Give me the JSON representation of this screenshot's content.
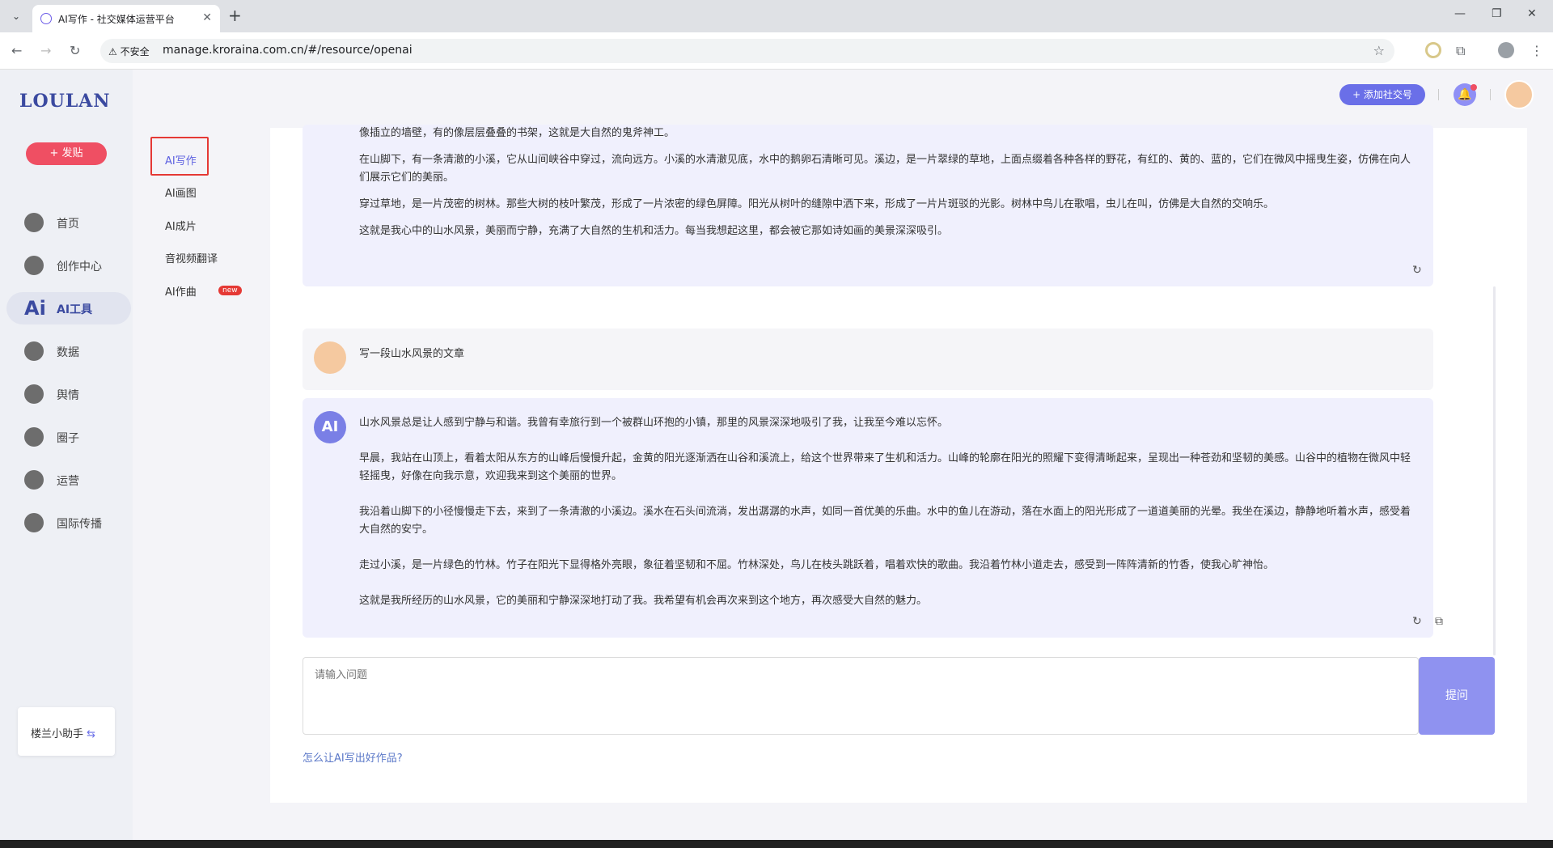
{
  "browser": {
    "tab_title": "AI写作 - 社交媒体运营平台",
    "insecure_label": "不安全",
    "url": "manage.kroraina.com.cn/#/resource/openai"
  },
  "sidebar": {
    "logo": "LOULAN",
    "post_button": "+ 发贴",
    "items": [
      {
        "label": "首页",
        "icon": "home-icon"
      },
      {
        "label": "创作中心",
        "icon": "palette-icon"
      },
      {
        "label": "AI工具",
        "icon": "ai-icon"
      },
      {
        "label": "数据",
        "icon": "database-icon"
      },
      {
        "label": "舆情",
        "icon": "quote-icon"
      },
      {
        "label": "圈子",
        "icon": "compass-icon"
      },
      {
        "label": "运营",
        "icon": "operations-icon"
      },
      {
        "label": "国际传播",
        "icon": "globe-icon"
      }
    ],
    "helper": "楼兰小助手"
  },
  "subnav": {
    "items": [
      "AI写作",
      "AI画图",
      "AI成片",
      "音视频翻译",
      "AI作曲"
    ],
    "new_badge": "new"
  },
  "header": {
    "add_account": "+ 添加社交号"
  },
  "chat": {
    "msg1": [
      "像插立的墙壁，有的像层层叠叠的书架，这就是大自然的鬼斧神工。",
      "在山脚下，有一条清澈的小溪，它从山间峡谷中穿过，流向远方。小溪的水清澈见底，水中的鹅卵石清晰可见。溪边，是一片翠绿的草地，上面点缀着各种各样的野花，有红的、黄的、蓝的，它们在微风中摇曳生姿，仿佛在向人们展示它们的美丽。",
      "穿过草地，是一片茂密的树林。那些大树的枝叶繁茂，形成了一片浓密的绿色屏障。阳光从树叶的缝隙中洒下来，形成了一片片斑驳的光影。树林中鸟儿在歌唱，虫儿在叫，仿佛是大自然的交响乐。",
      "这就是我心中的山水风景，美丽而宁静，充满了大自然的生机和活力。每当我想起这里，都会被它那如诗如画的美景深深吸引。"
    ],
    "user_msg": "写一段山水风景的文章",
    "ai_label": "AI",
    "msg2": [
      "山水风景总是让人感到宁静与和谐。我曾有幸旅行到一个被群山环抱的小镇，那里的风景深深地吸引了我，让我至今难以忘怀。",
      "早晨，我站在山顶上，看着太阳从东方的山峰后慢慢升起，金黄的阳光逐渐洒在山谷和溪流上，给这个世界带来了生机和活力。山峰的轮廓在阳光的照耀下变得清晰起来，呈现出一种苍劲和坚韧的美感。山谷中的植物在微风中轻轻摇曳，好像在向我示意，欢迎我来到这个美丽的世界。",
      "我沿着山脚下的小径慢慢走下去，来到了一条清澈的小溪边。溪水在石头间流淌，发出潺潺的水声，如同一首优美的乐曲。水中的鱼儿在游动，落在水面上的阳光形成了一道道美丽的光晕。我坐在溪边，静静地听着水声，感受着大自然的安宁。",
      "走过小溪，是一片绿色的竹林。竹子在阳光下显得格外亮眼，象征着坚韧和不屈。竹林深处，鸟儿在枝头跳跃着，唱着欢快的歌曲。我沿着竹林小道走去，感受到一阵阵清新的竹香，使我心旷神怡。",
      "这就是我所经历的山水风景，它的美丽和宁静深深地打动了我。我希望有机会再次来到这个地方，再次感受大自然的魅力。"
    ]
  },
  "composer": {
    "placeholder": "请输入问题",
    "submit": "提问",
    "tip": "怎么让AI写出好作品?"
  }
}
